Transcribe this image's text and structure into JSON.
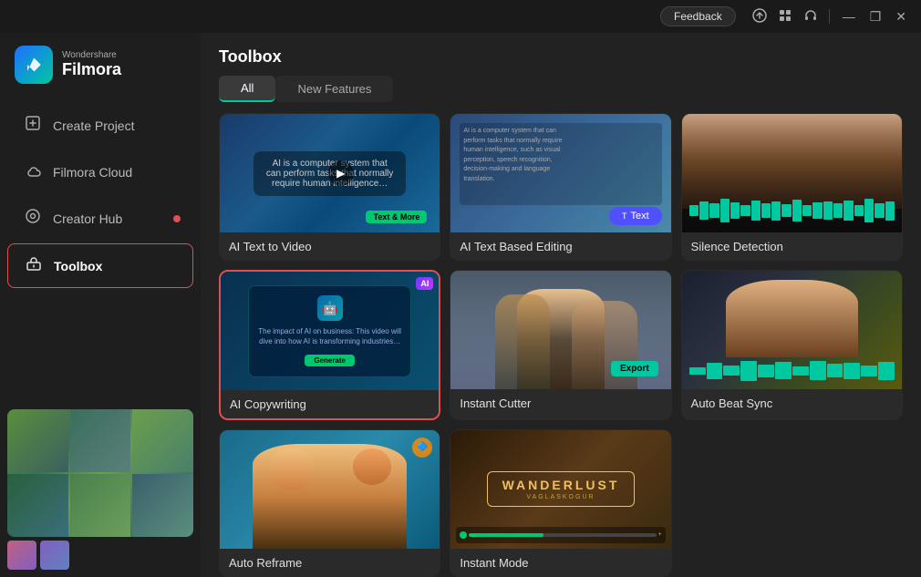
{
  "titlebar": {
    "feedback_label": "Feedback",
    "upload_icon": "⬆",
    "grid_icon": "⊞",
    "headset_icon": "🎧",
    "minimize_icon": "—",
    "restore_icon": "❐",
    "close_icon": "✕"
  },
  "sidebar": {
    "logo_top": "Wondershare",
    "logo_bottom": "Filmora",
    "nav_items": [
      {
        "id": "create-project",
        "label": "Create Project",
        "icon": "+"
      },
      {
        "id": "filmora-cloud",
        "label": "Filmora Cloud",
        "icon": "☁"
      },
      {
        "id": "creator-hub",
        "label": "Creator Hub",
        "icon": "◎",
        "has_dot": true
      },
      {
        "id": "toolbox",
        "label": "Toolbox",
        "icon": "🗃",
        "active": true
      }
    ]
  },
  "main": {
    "title": "Toolbox",
    "tabs": [
      {
        "id": "all",
        "label": "All",
        "active": true
      },
      {
        "id": "new-features",
        "label": "New Features",
        "active": false
      }
    ],
    "tools": [
      {
        "id": "ai-text-to-video",
        "label": "AI Text to Video",
        "thumb_type": "ai-text-video",
        "has_ai_badge": false,
        "selected": false
      },
      {
        "id": "ai-text-based-editing",
        "label": "AI Text Based Editing",
        "thumb_type": "text-based",
        "has_ai_badge": false,
        "selected": false
      },
      {
        "id": "silence-detection",
        "label": "Silence Detection",
        "thumb_type": "silence",
        "has_ai_badge": false,
        "selected": false
      },
      {
        "id": "ai-copywriting",
        "label": "AI Copywriting",
        "thumb_type": "copywriting",
        "has_ai_badge": true,
        "selected": true
      },
      {
        "id": "instant-cutter",
        "label": "Instant Cutter",
        "thumb_type": "instant-cutter",
        "has_ai_badge": false,
        "selected": false
      },
      {
        "id": "auto-beat-sync",
        "label": "Auto Beat Sync",
        "thumb_type": "auto-beat",
        "has_ai_badge": true,
        "selected": false
      },
      {
        "id": "auto-reframe",
        "label": "Auto Reframe",
        "thumb_type": "auto-reframe",
        "has_ai_badge": false,
        "selected": false
      },
      {
        "id": "instant-mode",
        "label": "Instant Mode",
        "thumb_type": "instant-mode",
        "has_ai_badge": true,
        "selected": false
      }
    ]
  }
}
